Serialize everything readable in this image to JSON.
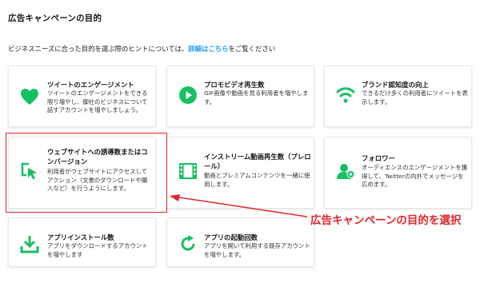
{
  "header": {
    "title": "広告キャンペーンの目的",
    "hint_prefix": "ビジネスニーズに合った目的を選ぶ際のヒントについては、",
    "hint_link": "詳細はこちら",
    "hint_suffix": "をご覧ください"
  },
  "objectives": [
    {
      "title": "ツイートのエンゲージメント",
      "desc": "ツイートのエンゲージメントをできる限り増やし、御社のビジネスについて話すアカウントを増やしましょう。"
    },
    {
      "title": "プロモビデオ再生数",
      "desc": "GIF画像や動画を見る利用者を増やします。"
    },
    {
      "title": "ブランド認知度の向上",
      "desc": "できるだけ多くの利用者にツイートを表示します。"
    },
    {
      "title": "ウェブサイトへの誘導数またはコンバージョン",
      "desc": "利用者がウェブサイトにアクセスしてアクション（文書のダウンロードや購入など）を行うようにします。"
    },
    {
      "title": "インストリーム動画再生数（プレロール）",
      "desc": "動画とプレミアムコンテンツを一緒に使用します。"
    },
    {
      "title": "フォロワー",
      "desc": "オーディエンスのエンゲージメントを獲得して、Twitterの内外でメッセージを広めます。"
    },
    {
      "title": "アプリインストール数",
      "desc": "アプリをダウンロードするアカウントを増やします"
    },
    {
      "title": "アプリの起動回数",
      "desc": "アプリを開いて利用する既存アカウントを増やします。"
    }
  ],
  "annotation": {
    "text": "広告キャンペーンの目的を選択"
  },
  "colors": {
    "accent_green": "#17bf63",
    "link_blue": "#1d9bf0",
    "annotation_red": "#e0262b"
  }
}
